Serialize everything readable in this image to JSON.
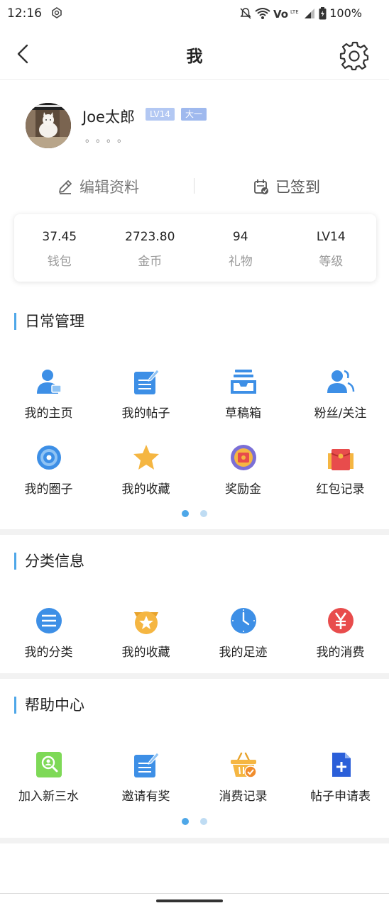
{
  "status_bar": {
    "time": "12:16",
    "battery": "100%",
    "icons": [
      "app-icon",
      "mute-icon",
      "wifi-icon",
      "volte-icon",
      "signal-icon",
      "battery-icon"
    ]
  },
  "nav": {
    "title": "我",
    "icons": [
      "back-icon",
      "gear-icon"
    ]
  },
  "profile": {
    "username": "Joe太郎",
    "level_badge": "LV14",
    "grade_badge": "大一",
    "signature": "。。。。",
    "edit_label": "编辑资料",
    "sign_label": "已签到"
  },
  "stats": [
    {
      "value": "37.45",
      "label": "钱包"
    },
    {
      "value": "2723.80",
      "label": "金币"
    },
    {
      "value": "94",
      "label": "礼物"
    },
    {
      "value": "LV14",
      "label": "等级"
    }
  ],
  "sections": {
    "daily": {
      "title": "日常管理",
      "items": [
        {
          "label": "我的主页",
          "icon": "person-icon"
        },
        {
          "label": "我的帖子",
          "icon": "post-edit-icon"
        },
        {
          "label": "草稿箱",
          "icon": "drafts-tray-icon"
        },
        {
          "label": "粉丝/关注",
          "icon": "followers-icon"
        },
        {
          "label": "我的圈子",
          "icon": "circle-target-icon"
        },
        {
          "label": "我的收藏",
          "icon": "star-icon"
        },
        {
          "label": "奖励金",
          "icon": "reward-icon"
        },
        {
          "label": "红包记录",
          "icon": "red-envelope-icon"
        }
      ],
      "pages": 2,
      "active_page": 1
    },
    "category": {
      "title": "分类信息",
      "items": [
        {
          "label": "我的分类",
          "icon": "list-icon"
        },
        {
          "label": "我的收藏",
          "icon": "star-badge-icon"
        },
        {
          "label": "我的足迹",
          "icon": "clock-icon"
        },
        {
          "label": "我的消费",
          "icon": "yen-icon"
        }
      ]
    },
    "help": {
      "title": "帮助中心",
      "items": [
        {
          "label": "加入新三水",
          "icon": "join-search-icon"
        },
        {
          "label": "邀请有奖",
          "icon": "invite-edit-icon"
        },
        {
          "label": "消费记录",
          "icon": "basket-check-icon"
        },
        {
          "label": "帖子申请表",
          "icon": "add-document-icon"
        }
      ],
      "pages": 2,
      "active_page": 1
    }
  },
  "colors": {
    "accent": "#4ea7e8",
    "icon_blue": "#3d8fe6",
    "badge_lv": "#b3c8f3",
    "badge_grade": "#9fb9ee",
    "red": "#e84c4c",
    "gold": "#f5b642",
    "green": "#7ed957"
  }
}
